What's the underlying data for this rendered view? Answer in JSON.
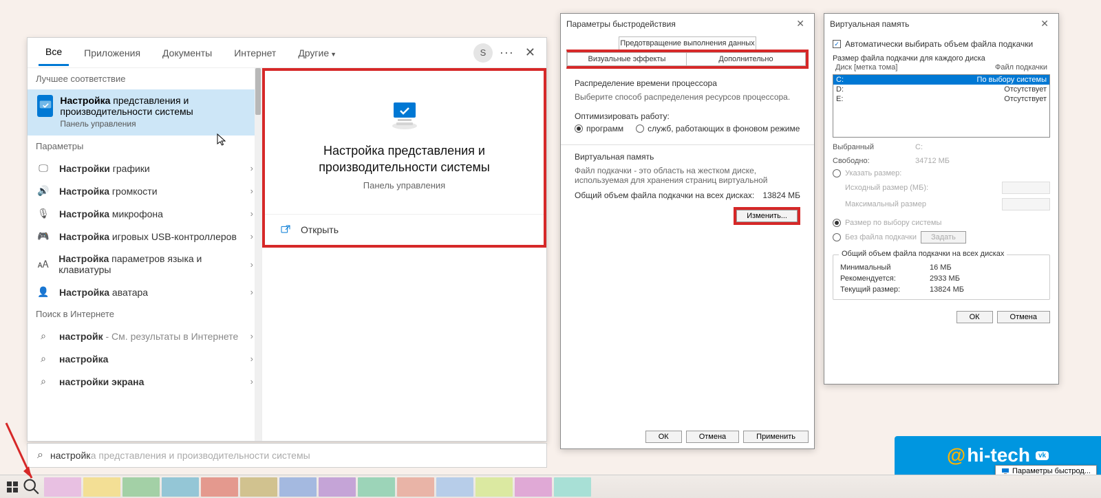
{
  "searchPanel": {
    "tabs": [
      "Все",
      "Приложения",
      "Документы",
      "Интернет",
      "Другие"
    ],
    "avatar": "S",
    "close": "✕",
    "sections": {
      "best": "Лучшее соответствие",
      "params": "Параметры",
      "web": "Поиск в Интернете"
    },
    "bestMatch": {
      "title_bold": "Настройка",
      "title_rest": " представления и производительности системы",
      "subtitle": "Панель управления"
    },
    "paramItems": [
      {
        "label_b": "Настройки",
        "label_r": " графики"
      },
      {
        "label_b": "Настройка",
        "label_r": " громкости"
      },
      {
        "label_b": "Настройка",
        "label_r": " микрофона"
      },
      {
        "label_b": "Настройка",
        "label_r": " игровых USB-контроллеров"
      },
      {
        "label_b": "Настройка",
        "label_r": " параметров языка и клавиатуры"
      },
      {
        "label_b": "Настройка",
        "label_r": " аватара"
      }
    ],
    "webItems": [
      {
        "bold": "настройк",
        "grey": " - См. результаты в Интернете"
      },
      {
        "bold": "настройка",
        "grey": ""
      },
      {
        "bold": "настройки",
        "grey_b": " экрана",
        "grey": ""
      }
    ],
    "preview": {
      "title": "Настройка представления и производительности системы",
      "subtitle": "Панель управления",
      "open": "Открыть"
    }
  },
  "searchBar": {
    "bold": "настройк",
    "grey": "а представления и производительности системы"
  },
  "perfDialog": {
    "title": "Параметры быстродействия",
    "tabTop": "Предотвращение выполнения данных",
    "tab1": "Визуальные эффекты",
    "tab2": "Дополнительно",
    "cpu_h": "Распределение времени процессора",
    "cpu_sub": "Выберите способ распределения ресурсов процессора.",
    "opt_label": "Оптимизировать работу:",
    "radio1": "программ",
    "radio2": "служб, работающих в фоновом режиме",
    "vm_h": "Виртуальная память",
    "vm_desc": "Файл подкачки - это область на жестком диске, используемая для хранения страниц виртуальной",
    "vm_total_label": "Общий объем файла подкачки на всех дисках:",
    "vm_total_value": "13824 МБ",
    "change": "Изменить...",
    "ok": "ОК",
    "cancel": "Отмена",
    "apply": "Применить"
  },
  "vmDialog": {
    "title": "Виртуальная память",
    "auto": "Автоматически выбирать объем файла подкачки",
    "each_label": "Размер файла подкачки для каждого диска",
    "head_drive": "Диск [метка тома]",
    "head_pf": "Файл подкачки",
    "drives": [
      {
        "d": "C:",
        "v": "По выбору системы",
        "sel": true
      },
      {
        "d": "D:",
        "v": "Отсутствует"
      },
      {
        "d": "E:",
        "v": "Отсутствует"
      }
    ],
    "selected_label": "Выбранный",
    "selected_drive": "C:",
    "free_label": "Свободно:",
    "free_value": "34712 МБ",
    "custom": "Указать размер:",
    "initial": "Исходный размер (МБ):",
    "maximum": "Максимальный размер",
    "system": "Размер по выбору системы",
    "none": "Без файла подкачки",
    "set": "Задать",
    "group_title": "Общий объем файла подкачки на всех дисках",
    "min_l": "Минимальный",
    "min_v": "16 МБ",
    "rec_l": "Рекомендуется:",
    "rec_v": "2933 МБ",
    "cur_l": "Текущий размер:",
    "cur_v": "13824 МБ",
    "ok": "ОК",
    "cancel": "Отмена"
  },
  "taskbar": {
    "tooltip": "Параметры быстрод...",
    "colors": [
      "#e8c0e2",
      "#f3df95",
      "#a3d0a6",
      "#94c6d6",
      "#e4998e",
      "#d1c28f",
      "#a4b9e0",
      "#c5a4d7",
      "#9cd4b8",
      "#e9b4a7",
      "#b7cde9",
      "#dbe9a1",
      "#e0a9d6",
      "#a8e0d6"
    ]
  },
  "watermark": {
    "at": "@",
    "text": "hi-tech",
    "vk": "vk"
  }
}
